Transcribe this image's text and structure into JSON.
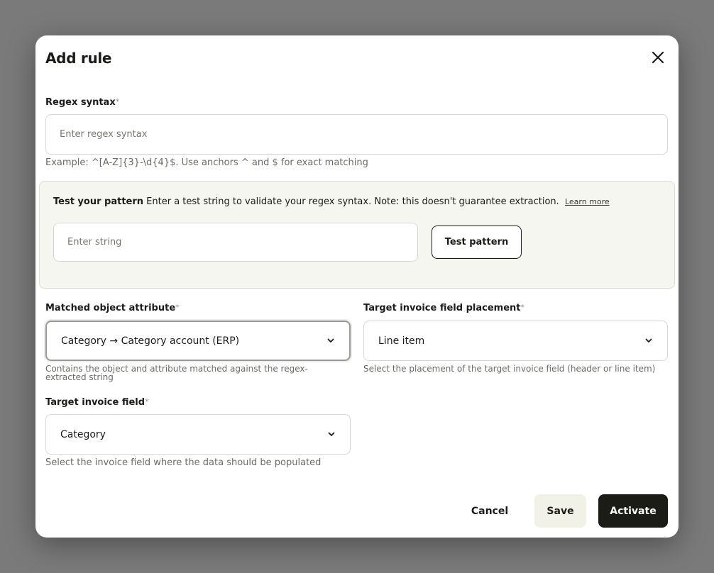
{
  "dialog": {
    "title": "Add rule"
  },
  "regex": {
    "label": "Regex syntax",
    "required_mark": "*",
    "placeholder": "Enter regex syntax",
    "value": "",
    "hint": "Example: ^[A-Z]{3}-\\d{4}$. Use anchors ^ and $ for exact matching"
  },
  "test_panel": {
    "title": "Test your pattern",
    "description": "Enter a test string to validate your regex syntax. Note: this doesn't guarantee extraction.",
    "learn_more": "Learn more",
    "input_placeholder": "Enter string",
    "input_value": "",
    "button_label": "Test pattern"
  },
  "matched_attribute": {
    "label": "Matched object attribute",
    "required_mark": "*",
    "value": "Category → Category account (ERP)",
    "hint": "Contains the object and attribute matched against the regex-extracted string"
  },
  "target_placement": {
    "label": "Target invoice field placement",
    "required_mark": "*",
    "value": "Line item",
    "hint": "Select the placement of the target invoice field (header or line item)"
  },
  "target_field": {
    "label": "Target invoice field",
    "required_mark": "*",
    "value": "Category",
    "hint": "Select the invoice field where the data should be populated"
  },
  "footer": {
    "cancel_label": "Cancel",
    "save_label": "Save",
    "activate_label": "Activate"
  },
  "icons": {
    "close": "close-icon",
    "chevron": "chevron-down-icon"
  },
  "colors": {
    "primary": "#1b1b18",
    "panel_bg": "#f6f6f0",
    "save_bg": "#f1f1e7"
  }
}
